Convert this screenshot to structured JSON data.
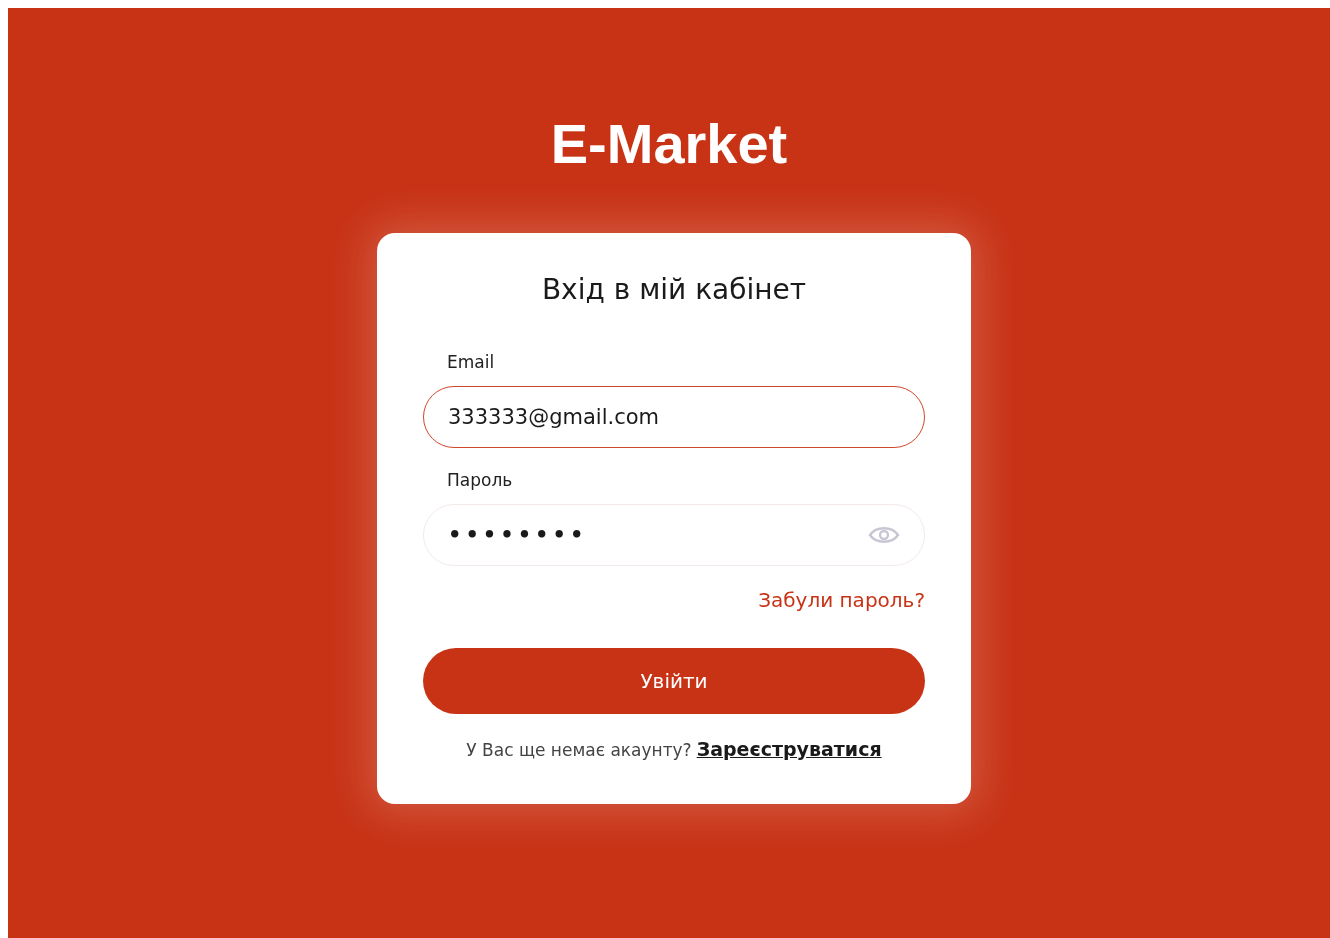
{
  "brand": "E-Market",
  "card": {
    "title": "Вхід в мій кабінет",
    "fields": [
      {
        "kind": "text",
        "label": "Email",
        "value": "333333@gmail.com",
        "focused": true
      },
      {
        "kind": "password",
        "label": "Пароль",
        "value": "••••••••",
        "focused": false
      }
    ],
    "forgot_link": "Забули пароль?",
    "submit_button": "Увійти",
    "signup_prompt": "У Вас ще немає акаунту?",
    "signup_link": "Зареєструватися"
  }
}
